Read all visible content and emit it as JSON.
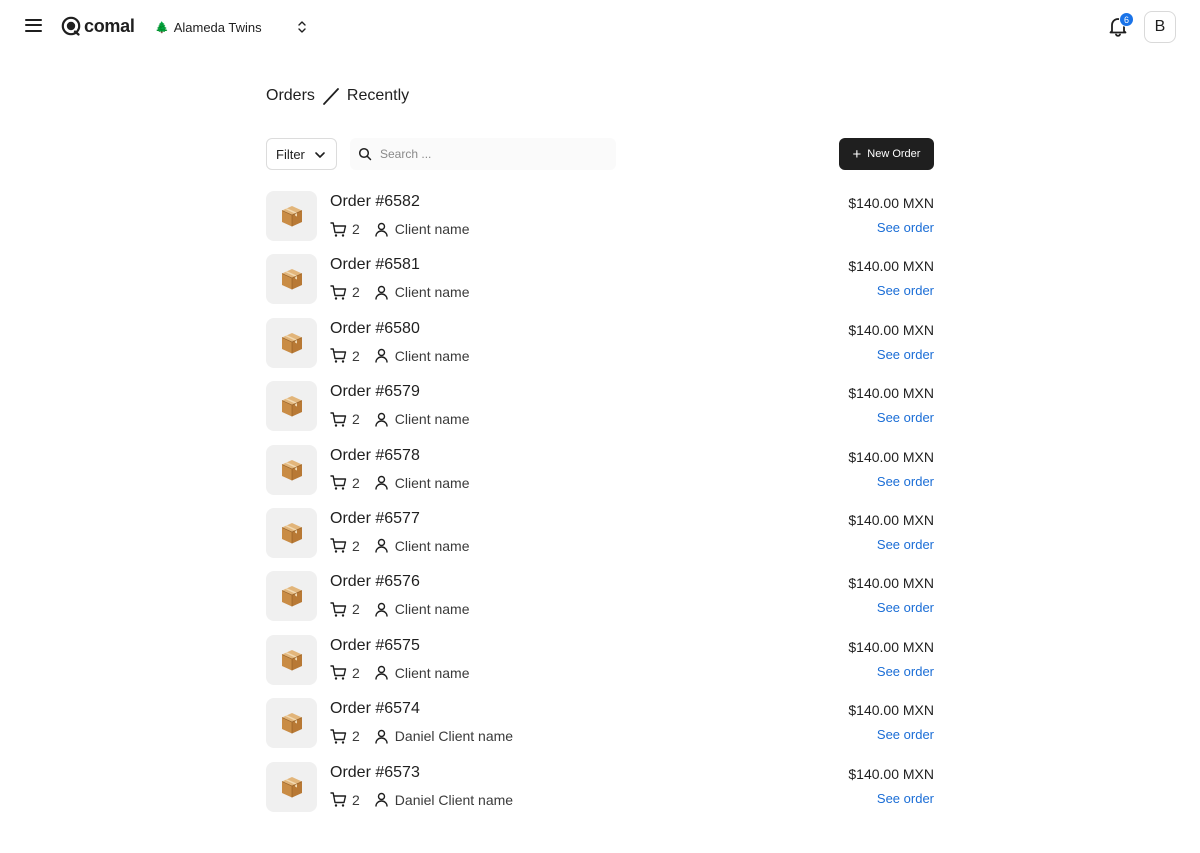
{
  "header": {
    "app_name": "comal",
    "store": {
      "icon": "evergreen-tree-emoji",
      "name": "Alameda Twins"
    },
    "notifications": {
      "count": "6"
    },
    "avatar_initial": "B"
  },
  "breadcrumb": {
    "root": "Orders",
    "current": "Recently"
  },
  "toolbar": {
    "filter_label": "Filter",
    "search_placeholder": "Search ...",
    "new_order_label": "New Order"
  },
  "orders": [
    {
      "title": "Order #6582",
      "qty": "2",
      "client": "Client name",
      "price": "$140.00 MXN",
      "link": "See order"
    },
    {
      "title": "Order #6581",
      "qty": "2",
      "client": "Client name",
      "price": "$140.00 MXN",
      "link": "See order"
    },
    {
      "title": "Order #6580",
      "qty": "2",
      "client": "Client name",
      "price": "$140.00 MXN",
      "link": "See order"
    },
    {
      "title": "Order #6579",
      "qty": "2",
      "client": "Client name",
      "price": "$140.00 MXN",
      "link": "See order"
    },
    {
      "title": "Order #6578",
      "qty": "2",
      "client": "Client name",
      "price": "$140.00 MXN",
      "link": "See order"
    },
    {
      "title": "Order #6577",
      "qty": "2",
      "client": "Client name",
      "price": "$140.00 MXN",
      "link": "See order"
    },
    {
      "title": "Order #6576",
      "qty": "2",
      "client": "Client name",
      "price": "$140.00 MXN",
      "link": "See order"
    },
    {
      "title": "Order #6575",
      "qty": "2",
      "client": "Client name",
      "price": "$140.00 MXN",
      "link": "See order"
    },
    {
      "title": "Order #6574",
      "qty": "2",
      "client": "Daniel Client name",
      "price": "$140.00 MXN",
      "link": "See order"
    },
    {
      "title": "Order #6573",
      "qty": "2",
      "client": "Daniel Client name",
      "price": "$140.00 MXN",
      "link": "See order"
    }
  ],
  "colors": {
    "accent": "#1a73e8",
    "link": "#1a6dd6",
    "primary_button": "#1f1f1f"
  }
}
